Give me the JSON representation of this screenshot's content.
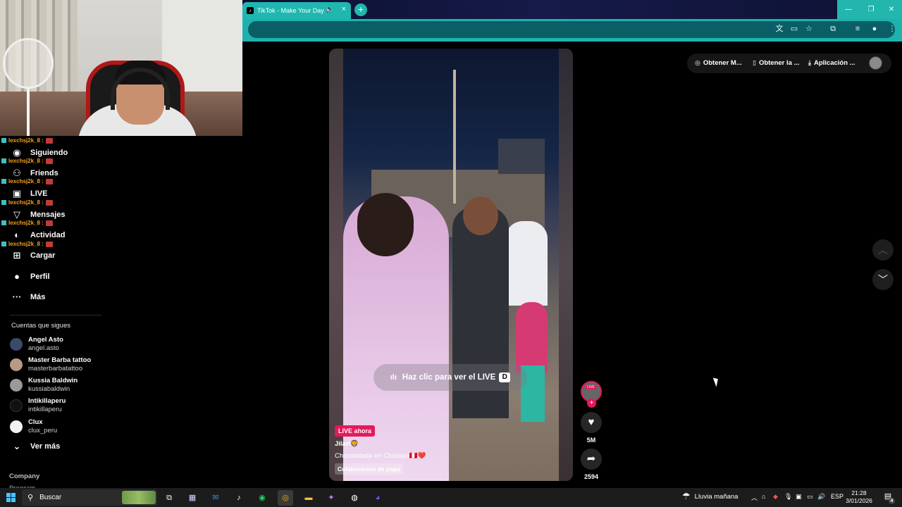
{
  "browser": {
    "tab_title": "TikTok - Make Your Day",
    "tab_close": "×",
    "new_tab": "+",
    "window_controls": [
      "—",
      "❐",
      "✕"
    ]
  },
  "sidebar": {
    "nav_items": [
      {
        "label": "Siguiendo",
        "icon": "user-icon",
        "glyph": "◉"
      },
      {
        "label": "Friends",
        "icon": "friends-icon",
        "glyph": "⚇"
      },
      {
        "label": "LIVE",
        "icon": "live-icon",
        "glyph": "▣"
      },
      {
        "label": "Mensajes",
        "icon": "message-icon",
        "glyph": "▽"
      },
      {
        "label": "Actividad",
        "icon": "activity-icon",
        "glyph": "◐"
      },
      {
        "label": "Cargar",
        "icon": "upload-icon",
        "glyph": "⊞"
      },
      {
        "label": "Perfil",
        "icon": "profile-icon",
        "glyph": "●"
      },
      {
        "label": "Más",
        "icon": "more-icon",
        "glyph": "···"
      }
    ],
    "chat_user": "lexchsj2k_8 :",
    "following_title": "Cuentas que sigues",
    "following": [
      {
        "name": "Angel Asto",
        "user": "angel.asto"
      },
      {
        "name": "Master Barba tattoo",
        "user": "masterbarbatattoo"
      },
      {
        "name": "Kussia Baldwin",
        "user": "kussiabaldwin"
      },
      {
        "name": "Intikillaperu",
        "user": "intikillaperu"
      },
      {
        "name": "Clux",
        "user": "clux_peru"
      }
    ],
    "see_more": "Ver más",
    "company": "Company",
    "program": "Program"
  },
  "video": {
    "live_cta": "Haz clic para ver el LIVE",
    "live_key": "D",
    "live_badge": "LIVE ahora",
    "author": "Jilari🦁",
    "caption": "Chocolatada en Chiclayo🇵🇪❤️",
    "paid_label": "Colaboración de pago"
  },
  "rail": {
    "avatar_badge": "LIVE",
    "plus": "+",
    "likes": "5M",
    "shares": "2594"
  },
  "topbar": {
    "item1": "Obtener M...",
    "item2": "Obtener la ...",
    "item3": "Aplicación ..."
  },
  "taskbar": {
    "search": "Buscar",
    "weather": "Lluvia mañana",
    "lang": "ESP",
    "time": "21:28",
    "date": "3/01/2026",
    "notifications": "4"
  },
  "colors": {
    "accent_teal": "#1fb7b0",
    "live_pink": "#e6195a",
    "chat_name": "#f4a11b"
  }
}
